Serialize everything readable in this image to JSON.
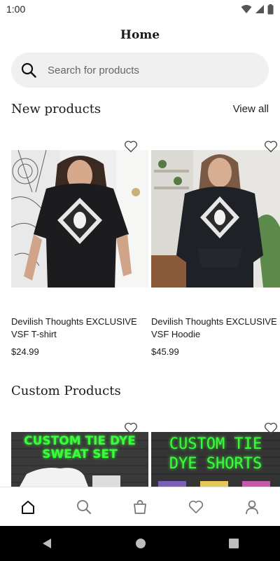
{
  "status_bar": {
    "time": "1:00"
  },
  "header": {
    "title": "Home"
  },
  "search": {
    "placeholder": "Search for products"
  },
  "new_products": {
    "title": "New products",
    "view_all_label": "View all",
    "items": [
      {
        "name": "Devilish Thoughts EXCLUSIVE VSF T-shirt",
        "price": "$24.99"
      },
      {
        "name": "Devilish Thoughts EXCLUSIVE VSF Hoodie",
        "price": "$45.99"
      }
    ]
  },
  "custom_products": {
    "title": "Custom Products",
    "items": [
      {
        "image_text": "CUSTOM TIE DYE SWEAT SET"
      },
      {
        "image_text": "CUSTOM TIE DYE SHORTS"
      }
    ]
  },
  "bottom_nav": {
    "items": [
      "home-icon",
      "search-icon",
      "shopping-bag-icon",
      "heart-icon",
      "profile-icon"
    ]
  },
  "colors": {
    "neon_green": "#39ff3a",
    "search_bg": "#f0f0f0",
    "brick": "#3a3a3a"
  }
}
